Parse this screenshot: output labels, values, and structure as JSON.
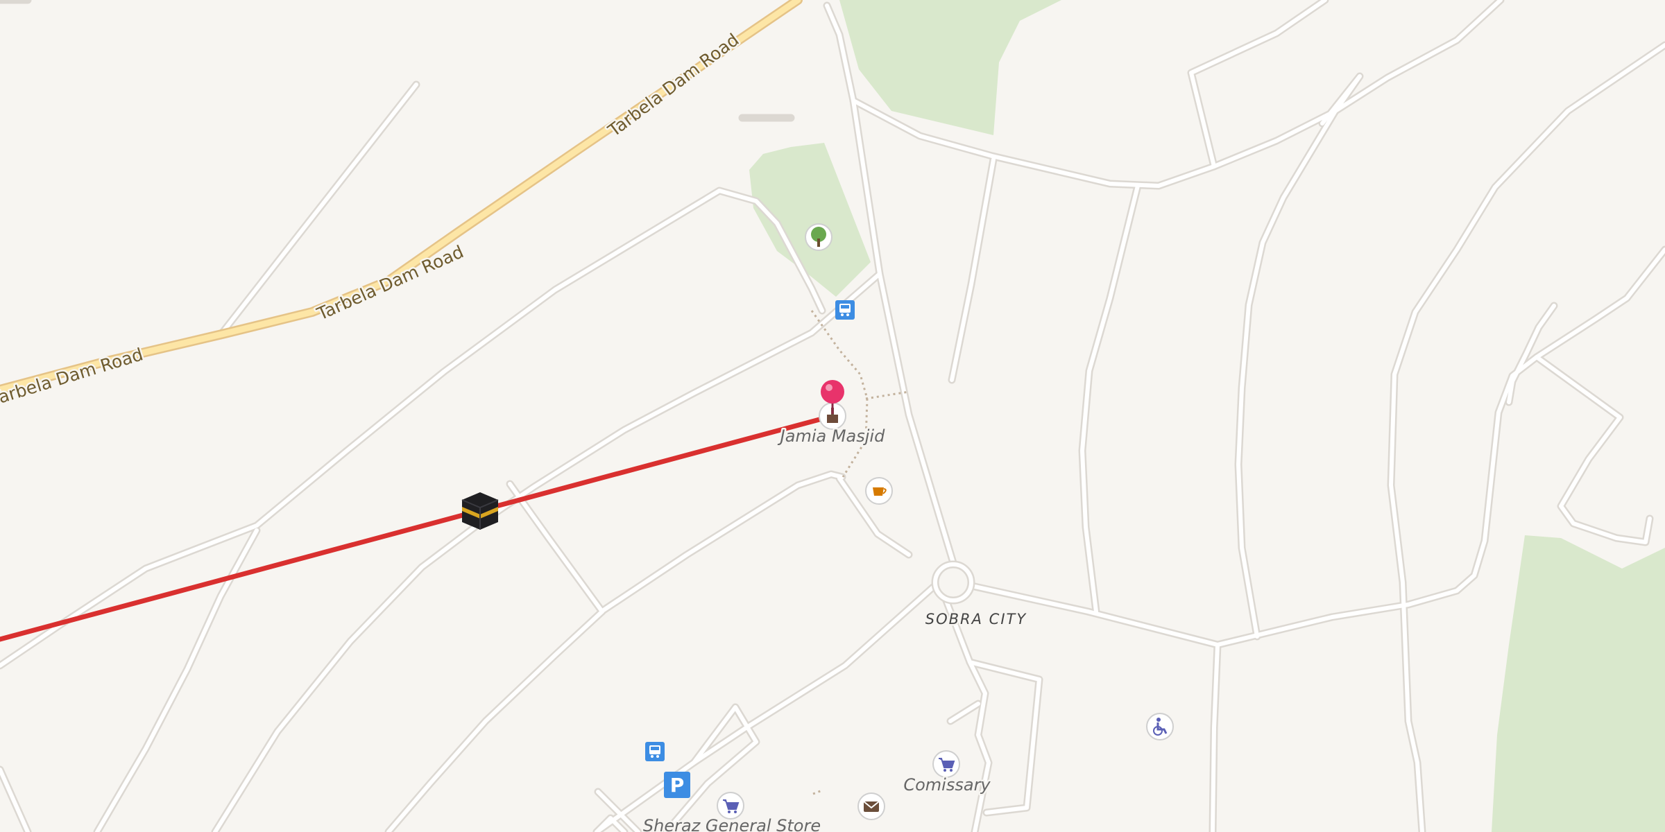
{
  "map": {
    "roads": {
      "primary_name": "Tarbela Dam Road"
    },
    "labels": {
      "area": "SOBRA CITY",
      "mosque": "Jamia Masjid",
      "shop1": "Comissary",
      "shop2": "Sheraz General Store"
    },
    "icons": [
      "tree-icon",
      "bus-stop-icon",
      "mosque-icon",
      "cafe-icon",
      "parking-icon",
      "shopping-cart-icon",
      "post-office-icon",
      "wheelchair-icon",
      "kaaba-icon",
      "location-pin-icon"
    ],
    "parking_glyph": "P",
    "colors": {
      "background": "#f7f5f1",
      "park": "#d9e8cc",
      "primary_road": "#fde6a6",
      "qibla_line": "#d9302f",
      "pin": "#e8336b",
      "bus_stop": "#3d8de3",
      "shop": "#5a5fb5",
      "cafe": "#d67a00"
    }
  }
}
